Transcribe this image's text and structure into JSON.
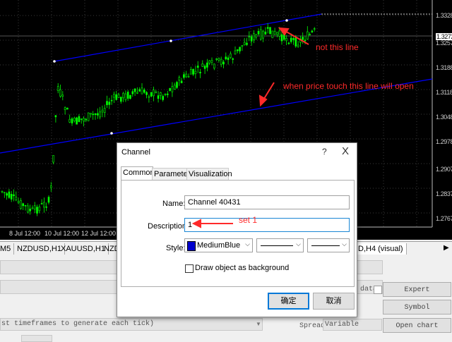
{
  "prices": [
    "1.3328",
    "1.3257",
    "1.3188",
    "1.3118",
    "1.3048",
    "1.2978",
    "1.2907",
    "1.2837",
    "1.2767"
  ],
  "current_price": "1.3272",
  "time_labels": [
    "8 Jul 12:00",
    "10 Jul 12:00",
    "12 Jul 12:00"
  ],
  "annotations": {
    "not_this_line": "not this line",
    "touch_line": "when price touch this line will open",
    "set_1": "set 1"
  },
  "symbol_tabs": [
    "M5",
    "NZDUSD,H1",
    "XAUUSD,H1",
    "NZDU",
    "D,H4 (visual)"
  ],
  "tester": {
    "timeframes_hint": "st timeframes to generate each tick)",
    "data_label": "data",
    "spread_label": "Spread:",
    "spread_value": "Variable",
    "expert_properties": "Expert properties",
    "symbol_properties": "Symbol properties",
    "open_chart": "Open chart"
  },
  "dialog": {
    "title": "Channel",
    "help": "?",
    "close": "X",
    "tabs": [
      "Common",
      "Parameters",
      "Visualization"
    ],
    "name_label": "Name:",
    "name_value": "Channel 40431",
    "description_label": "Description:",
    "description_value": "1",
    "style_label": "Style:",
    "color_name": "MediumBlue",
    "color_swatch": "#0000cd",
    "draw_background_label": "Draw object as background",
    "ok": "确定",
    "cancel": "取消"
  },
  "colors": {
    "chart_bg": "#000000",
    "candle": "#00ff00",
    "channel": "#0000ff",
    "annotation": "#ff2a2a",
    "accent": "#0078d7"
  }
}
